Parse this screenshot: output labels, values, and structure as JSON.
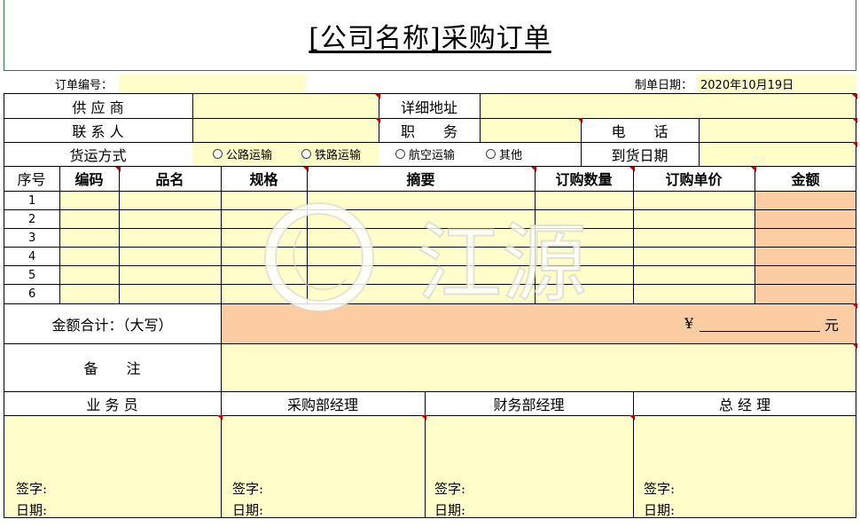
{
  "title": "[公司名称]采购订单",
  "header": {
    "order_no_label": "订单编号：",
    "order_no_value": "",
    "date_label": "制单日期：",
    "date_value": "2020年10月19日"
  },
  "info": {
    "supplier_label": "供 应 商",
    "address_label": "详细地址",
    "contact_label": "联 系 人",
    "position_label": "职　　务",
    "phone_label": "电　　话",
    "shipping_label": "货运方式",
    "shipping_options": [
      "公路运输",
      "铁路运输",
      "航空运输",
      "其他"
    ],
    "arrival_label": "到货日期"
  },
  "table": {
    "headers": [
      "序号",
      "编码",
      "品名",
      "规格",
      "摘要",
      "订购数量",
      "订购单价",
      "金额"
    ],
    "rows": [
      "1",
      "2",
      "3",
      "4",
      "5",
      "6"
    ]
  },
  "total": {
    "label": "金额合计：（大写）",
    "currency": "¥",
    "unit": "元"
  },
  "remark": {
    "label": "备　　注"
  },
  "signatures": {
    "roles": [
      "业 务 员",
      "采购部经理",
      "财务部经理",
      "总 经 理"
    ],
    "sign_label": "签字:",
    "date_label": "日期:"
  },
  "watermark": {
    "text": "江源"
  },
  "colors": {
    "input_fill": "#fffdc9",
    "amount_fill": "#fccda2",
    "comment_marker": "#c00000"
  }
}
